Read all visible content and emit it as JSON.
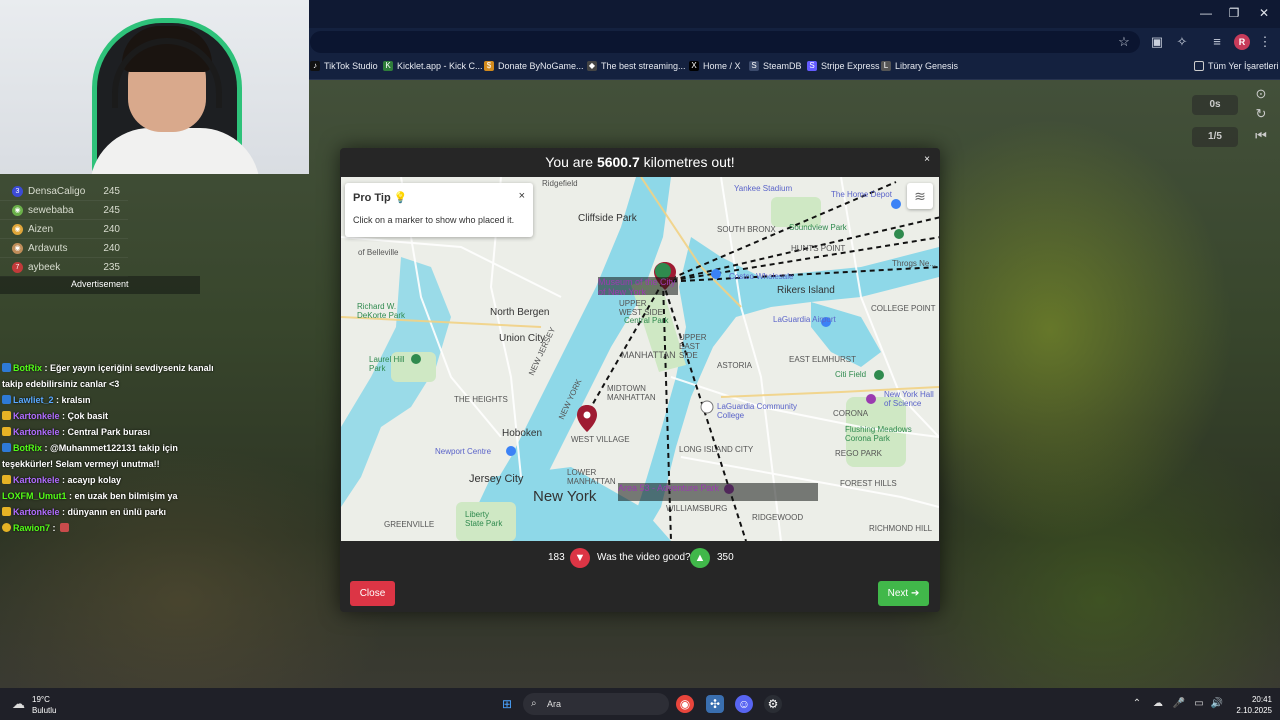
{
  "browser": {
    "bookmarks": [
      {
        "label": "TikTok Studio",
        "icon": "tiktok-icon",
        "color": "#111111"
      },
      {
        "label": "Kicklet.app - Kick C...",
        "icon": "kicklet-icon",
        "color": "#2f7d3a"
      },
      {
        "label": "Donate ByNoGame...",
        "icon": "donate-icon",
        "color": "#d28a1c"
      },
      {
        "label": "The best streaming...",
        "icon": "streaming-icon",
        "color": "#444444"
      },
      {
        "label": "Home / X",
        "icon": "x-icon",
        "color": "#000000"
      },
      {
        "label": "SteamDB",
        "icon": "steamdb-icon",
        "color": "#3b4a6b"
      },
      {
        "label": "Stripe Express",
        "icon": "stripe-icon",
        "color": "#635bff"
      },
      {
        "label": "Library Genesis",
        "icon": "library-icon",
        "color": "#555555"
      }
    ],
    "all_bookmarks_label": "Tüm Yer İşaretleri",
    "profile_initial": "R"
  },
  "leaderboard": [
    {
      "name": "DensaCaligo",
      "points": "245",
      "color": "#3c4bd6"
    },
    {
      "name": "sewebaba",
      "points": "245",
      "color": "#6bb04a"
    },
    {
      "name": "Aizen",
      "points": "240",
      "color": "#e0a63a"
    },
    {
      "name": "Ardavuts",
      "points": "240",
      "color": "#c08d5a"
    },
    {
      "name": "aybeek",
      "points": "235",
      "color": "#c23a3a",
      "rank": "7"
    }
  ],
  "advertisement_label": "Advertisement",
  "chat": [
    {
      "user": "BotRix",
      "user_color": "#53fc18",
      "text": " : Eğer yayın içeriğini sevdiyseniz kanalı takip edebilirsiniz canlar <3"
    },
    {
      "user": "Lawliet_2",
      "user_color": "#5aa9ff",
      "text": " : kralsın"
    },
    {
      "user": "Kartonkele",
      "user_color": "#b06cff",
      "text": " : Çok basit"
    },
    {
      "user": "Kartonkele",
      "user_color": "#b06cff",
      "text": " : Central Park burası"
    },
    {
      "user": "BotRix",
      "user_color": "#53fc18",
      "text": " : @Muhammet122131 takip için teşekkürler! Selam vermeyi unutma!!"
    },
    {
      "user": "Kartonkele",
      "user_color": "#b06cff",
      "text": " : acayıp kolay"
    },
    {
      "user": "LOXFM_Umut1",
      "user_color": "#53fc18",
      "text": " : en uzak ben bilmişim ya"
    },
    {
      "user": "Kartonkele",
      "user_color": "#b06cff",
      "text": " : dünyanın en ünlü parkı"
    },
    {
      "user": "Rawion7",
      "user_color": "#53fc18",
      "text": " : "
    }
  ],
  "hud": {
    "timer": "0s",
    "round": "1/5"
  },
  "result": {
    "title_prefix": "You are ",
    "distance": "5600.7",
    "title_suffix": " kilometres out!",
    "close_x": "×"
  },
  "protip": {
    "title": "Pro Tip 💡",
    "close": "×",
    "text": "Click on a marker to show who placed it."
  },
  "map_labels": [
    "Ridgefield",
    "Yankee Stadium",
    "The Home Depot",
    "Cliffside Park",
    "SOUTH BRONX",
    "Soundview Park",
    "HUNTS POINT",
    "of Belleville",
    "Museum of the City of New York",
    "Costco Wholesale",
    "Rikers Island",
    "North Bergen",
    "UPPER WEST SIDE",
    "Central Park",
    "UPPER EAST SIDE",
    "LaGuardia Airport",
    "COLLEGE POINT",
    "Richard W. DeKorte Park",
    "Union City",
    "MANHATTAN",
    "ASTORIA",
    "EAST ELMHURST",
    "Laurel Hill Park",
    "Citi Field",
    "New York Hall of Science",
    "THE HEIGHTS",
    "MIDTOWN MANHATTAN",
    "LaGuardia Community College",
    "CORONA",
    "Flushing Meadows Corona Park",
    "Hoboken",
    "WEST VILLAGE",
    "Newport Centre",
    "Jersey City",
    "Area 53 - Adventure Park",
    "New York",
    "LOWER MANHATTAN",
    "REGO PARK",
    "Liberty State Park",
    "GREENVILLE",
    "WILLIAMSBURG",
    "RIDGEWOOD",
    "FOREST HILLS",
    "RICHMOND HILL",
    "NEW JERSEY",
    "NEW YORK",
    "LONG ISLAND CITY",
    "Throgs Ne..."
  ],
  "vote": {
    "dislikes": "183",
    "question": "Was the video good?",
    "likes": "350"
  },
  "buttons": {
    "close": "Close",
    "next": "Next ➔"
  },
  "taskbar": {
    "weather_temp": "19°C",
    "weather_desc": "Bulutlu",
    "search_placeholder": "Ara",
    "time": "20:41",
    "date": "2.10.2025"
  },
  "colors": {
    "accent_green": "#41b84a",
    "close_red": "#dc3545",
    "modal_bg": "#262626"
  }
}
